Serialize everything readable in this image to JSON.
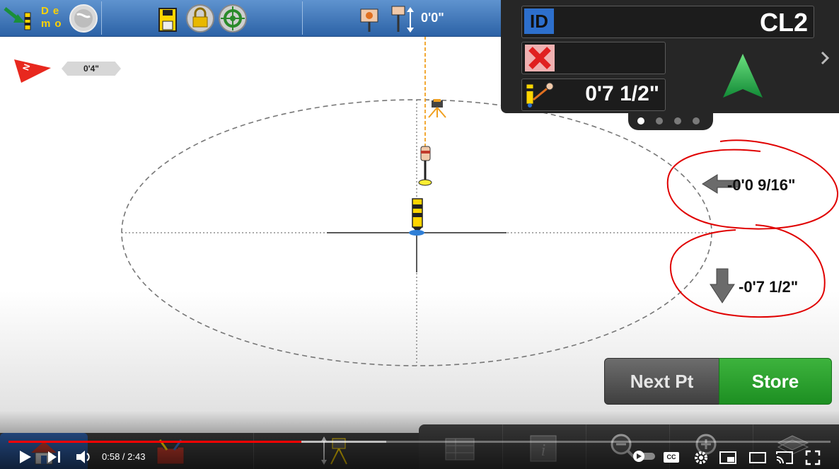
{
  "toolbar": {
    "demo_label": "De mo",
    "target_height": "0'0\""
  },
  "info_panel": {
    "point_id_label": "ID",
    "point_id": "CL2",
    "distance_value": "0'7 1/2\"",
    "page_count": 4,
    "active_page": 1
  },
  "map": {
    "scale_label": "0'4\"",
    "north_label": "N",
    "offset_horizontal": "-0'0 9/16\"",
    "offset_vertical": "-0'7 1/2\""
  },
  "buttons": {
    "next_point": "Next Pt",
    "store": "Store"
  },
  "video": {
    "time_display": "0:58 / 2:43",
    "progress_fraction": 0.356,
    "captions_label": "CC"
  },
  "colors": {
    "toolbar_blue": "#3f77bb",
    "panel_dark": "#262626",
    "store_green": "#1d8f22",
    "annotation_red": "#e00000",
    "progress_red": "#ff0000",
    "arrow_green": "#1aa64a"
  },
  "icons": [
    "arrive-point-icon",
    "globe-icon",
    "save-icon",
    "lock-icon",
    "target-icon",
    "prism-icon",
    "rod-height-icon",
    "nav-arrow-icon",
    "north-arrow-icon",
    "home-icon",
    "toolbox-icon",
    "instrument-icon",
    "table-icon",
    "info-icon",
    "zoom-out-icon",
    "zoom-in-icon",
    "layers-icon",
    "play-icon",
    "volume-icon",
    "settings-icon",
    "miniplayer-icon",
    "theater-icon",
    "cast-icon",
    "fullscreen-icon"
  ]
}
